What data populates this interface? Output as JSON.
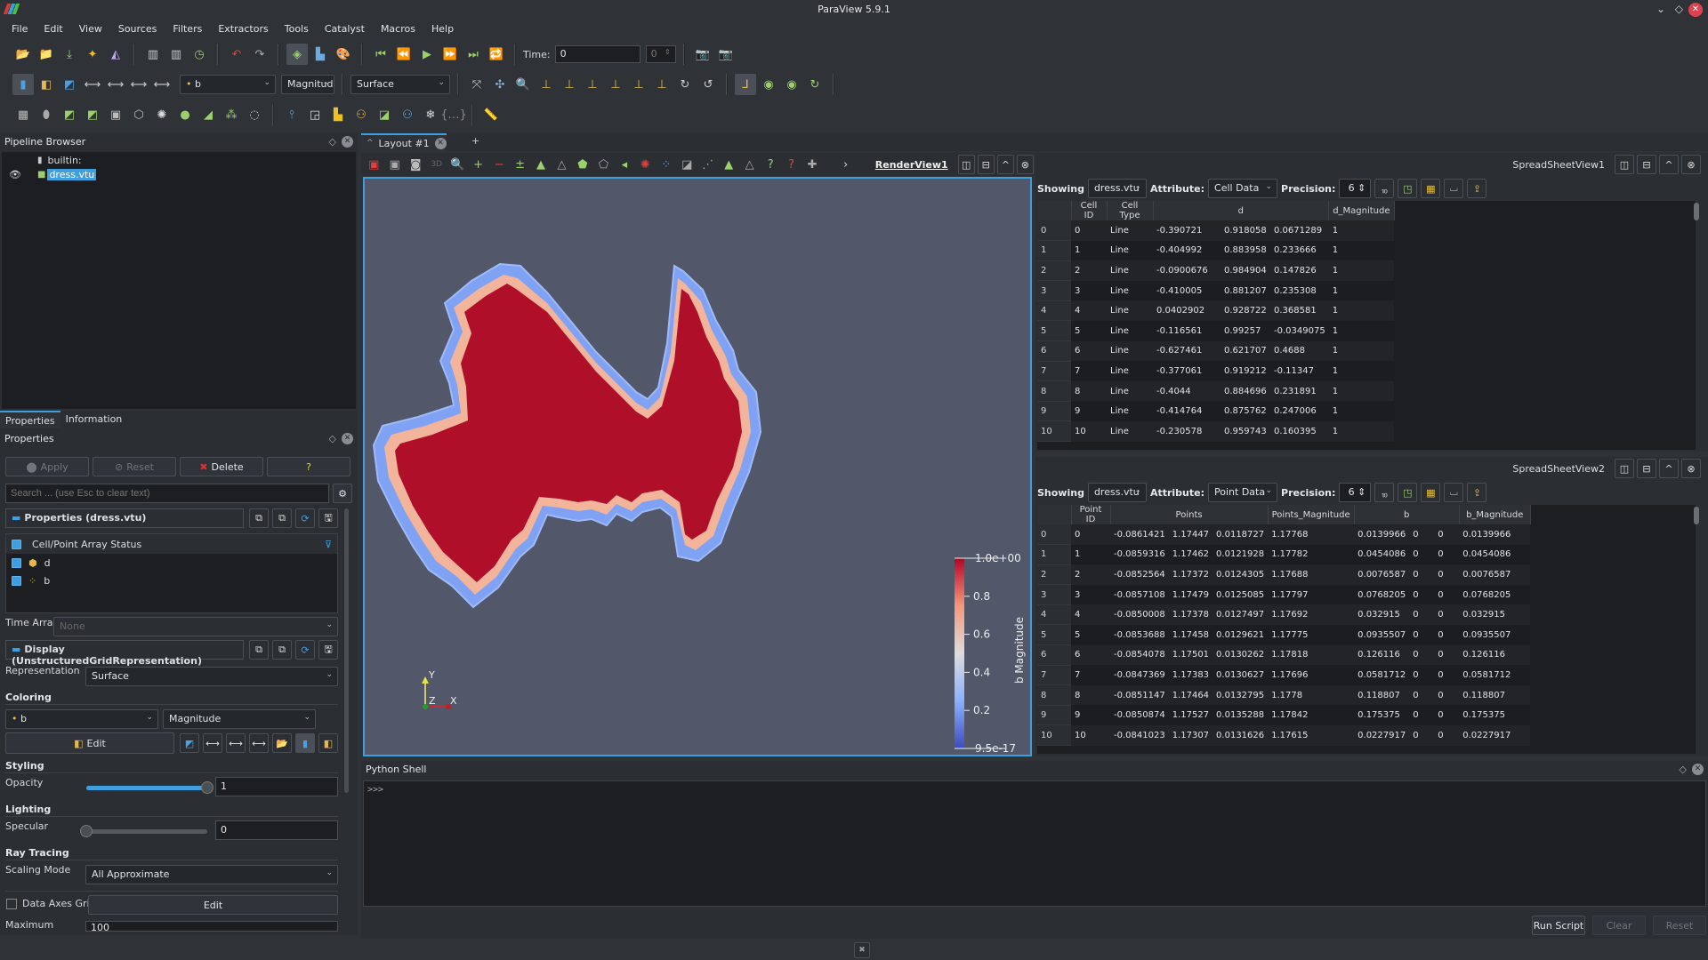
{
  "window": {
    "title": "ParaView 5.9.1"
  },
  "menu": [
    "File",
    "Edit",
    "View",
    "Sources",
    "Filters",
    "Extractors",
    "Tools",
    "Catalyst",
    "Macros",
    "Help"
  ],
  "toolbar": {
    "time_label": "Time:",
    "time_value": "0",
    "time_step": "0",
    "color_array": "b",
    "color_component": "Magnitud",
    "representation": "Surface"
  },
  "pipeline": {
    "title": "Pipeline Browser",
    "items": [
      {
        "label": "builtin:"
      },
      {
        "label": "dress.vtu",
        "selected": true,
        "visible": true
      }
    ]
  },
  "properties": {
    "tabs": [
      "Properties",
      "Information"
    ],
    "title": "Properties",
    "apply": "Apply",
    "reset": "Reset",
    "delete": "Delete",
    "help": "?",
    "search_placeholder": "Search ... (use Esc to clear text)",
    "group1": "Properties (dress.vtu)",
    "array_status_header": "Cell/Point Array Status",
    "arrays": [
      {
        "name": "d",
        "type": "cell",
        "checked": true
      },
      {
        "name": "b",
        "type": "point",
        "checked": true
      }
    ],
    "time_array_label": "Time Array",
    "time_array_value": "None",
    "group2": "Display (UnstructuredGridRepresentation)",
    "representation_label": "Representation",
    "representation_value": "Surface",
    "coloring_label": "Coloring",
    "coloring_array": "b",
    "coloring_component": "Magnitude",
    "edit_label": "Edit",
    "styling_label": "Styling",
    "opacity_label": "Opacity",
    "opacity_value": "1",
    "opacity_fraction": 1.0,
    "lighting_label": "Lighting",
    "specular_label": "Specular",
    "specular_value": "0",
    "specular_fraction": 0.0,
    "raytracing_label": "Ray Tracing",
    "scaling_mode_label": "Scaling Mode",
    "scaling_mode_value": "All Approximate",
    "data_axes_grid_label": "Data Axes Grid",
    "data_axes_grid_checked": false,
    "data_axes_edit": "Edit",
    "maximum_label": "Maximum",
    "maximum_value": "100"
  },
  "layout": {
    "tab": "Layout #1",
    "add_tab": "+",
    "render_view": "RenderView1",
    "colorbar": {
      "title": "b Magnitude",
      "max_label": "1.0e+00",
      "min_label": "9.5e-17",
      "ticks": [
        "0.8",
        "0.6",
        "0.4",
        "0.2"
      ]
    },
    "axes": {
      "x": "X",
      "y": "Y",
      "z": "Z"
    }
  },
  "spreadsheet1": {
    "name": "SpreadSheetView1",
    "showing_label": "Showing",
    "showing": "dress.vtu",
    "attribute_label": "Attribute:",
    "attribute": "Cell Data",
    "precision_label": "Precision:",
    "precision": "6",
    "columns": [
      "",
      "Cell ID",
      "Cell Type",
      "d",
      "",
      "",
      "d_Magnitude"
    ],
    "rows": [
      [
        "0",
        "0",
        "Line",
        "-0.390721",
        "0.918058",
        "0.0671289",
        "1"
      ],
      [
        "1",
        "1",
        "Line",
        "-0.404992",
        "0.883958",
        "0.233666",
        "1"
      ],
      [
        "2",
        "2",
        "Line",
        "-0.0900676",
        "0.984904",
        "0.147826",
        "1"
      ],
      [
        "3",
        "3",
        "Line",
        "-0.410005",
        "0.881207",
        "0.235308",
        "1"
      ],
      [
        "4",
        "4",
        "Line",
        "0.0402902",
        "0.928722",
        "0.368581",
        "1"
      ],
      [
        "5",
        "5",
        "Line",
        "-0.116561",
        "0.99257",
        "-0.0349075",
        "1"
      ],
      [
        "6",
        "6",
        "Line",
        "-0.627461",
        "0.621707",
        "0.4688",
        "1"
      ],
      [
        "7",
        "7",
        "Line",
        "-0.377061",
        "0.919212",
        "-0.11347",
        "1"
      ],
      [
        "8",
        "8",
        "Line",
        "-0.4044",
        "0.884696",
        "0.231891",
        "1"
      ],
      [
        "9",
        "9",
        "Line",
        "-0.414764",
        "0.875762",
        "0.247006",
        "1"
      ],
      [
        "10",
        "10",
        "Line",
        "-0.230578",
        "0.959743",
        "0.160395",
        "1"
      ]
    ]
  },
  "spreadsheet2": {
    "name": "SpreadSheetView2",
    "showing_label": "Showing",
    "showing": "dress.vtu",
    "attribute_label": "Attribute:",
    "attribute": "Point Data",
    "precision_label": "Precision:",
    "precision": "6",
    "columns": [
      "",
      "Point ID",
      "Points",
      "",
      "",
      "Points_Magnitude",
      "b",
      "",
      "",
      "b_Magnitude"
    ],
    "rows": [
      [
        "0",
        "0",
        "-0.0861421",
        "1.17447",
        "0.0118727",
        "1.17768",
        "0.0139966",
        "0",
        "0",
        "0.0139966"
      ],
      [
        "1",
        "1",
        "-0.0859316",
        "1.17462",
        "0.0121928",
        "1.17782",
        "0.0454086",
        "0",
        "0",
        "0.0454086"
      ],
      [
        "2",
        "2",
        "-0.0852564",
        "1.17372",
        "0.0124305",
        "1.17688",
        "0.0076587",
        "0",
        "0",
        "0.0076587"
      ],
      [
        "3",
        "3",
        "-0.0857108",
        "1.17479",
        "0.0125085",
        "1.17797",
        "0.0768205",
        "0",
        "0",
        "0.0768205"
      ],
      [
        "4",
        "4",
        "-0.0850008",
        "1.17378",
        "0.0127497",
        "1.17692",
        "0.032915",
        "0",
        "0",
        "0.032915"
      ],
      [
        "5",
        "5",
        "-0.0853688",
        "1.17458",
        "0.0129621",
        "1.17775",
        "0.0935507",
        "0",
        "0",
        "0.0935507"
      ],
      [
        "6",
        "6",
        "-0.0854078",
        "1.17501",
        "0.0130262",
        "1.17818",
        "0.126116",
        "0",
        "0",
        "0.126116"
      ],
      [
        "7",
        "7",
        "-0.0847369",
        "1.17383",
        "0.0130627",
        "1.17696",
        "0.0581712",
        "0",
        "0",
        "0.0581712"
      ],
      [
        "8",
        "8",
        "-0.0851147",
        "1.17464",
        "0.0132795",
        "1.1778",
        "0.118807",
        "0",
        "0",
        "0.118807"
      ],
      [
        "9",
        "9",
        "-0.0850874",
        "1.17527",
        "0.0135288",
        "1.17842",
        "0.175375",
        "0",
        "0",
        "0.175375"
      ],
      [
        "10",
        "10",
        "-0.0841023",
        "1.17307",
        "0.0131626",
        "1.17615",
        "0.0227917",
        "0",
        "0",
        "0.0227917"
      ]
    ]
  },
  "python_shell": {
    "title": "Python Shell",
    "prompt": ">>>",
    "run_script": "Run Script",
    "clear": "Clear",
    "reset": "Reset"
  },
  "colors": {
    "accent": "#3d9fe0",
    "surface_red": "#b40426",
    "render_bg": "#525769"
  }
}
